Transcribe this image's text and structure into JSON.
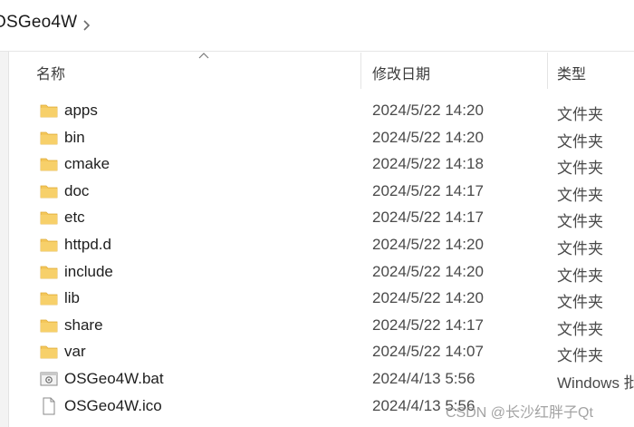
{
  "breadcrumb": {
    "label": "OSGeo4W"
  },
  "columns": {
    "name": "名称",
    "date": "修改日期",
    "type": "类型"
  },
  "files": [
    {
      "name": "apps",
      "date": "2024/5/22 14:20",
      "type": "文件夹",
      "icon": "folder-icon"
    },
    {
      "name": "bin",
      "date": "2024/5/22 14:20",
      "type": "文件夹",
      "icon": "folder-icon"
    },
    {
      "name": "cmake",
      "date": "2024/5/22 14:18",
      "type": "文件夹",
      "icon": "folder-icon"
    },
    {
      "name": "doc",
      "date": "2024/5/22 14:17",
      "type": "文件夹",
      "icon": "folder-icon"
    },
    {
      "name": "etc",
      "date": "2024/5/22 14:17",
      "type": "文件夹",
      "icon": "folder-icon"
    },
    {
      "name": "httpd.d",
      "date": "2024/5/22 14:20",
      "type": "文件夹",
      "icon": "folder-icon"
    },
    {
      "name": "include",
      "date": "2024/5/22 14:20",
      "type": "文件夹",
      "icon": "folder-icon"
    },
    {
      "name": "lib",
      "date": "2024/5/22 14:20",
      "type": "文件夹",
      "icon": "folder-icon"
    },
    {
      "name": "share",
      "date": "2024/5/22 14:17",
      "type": "文件夹",
      "icon": "folder-icon"
    },
    {
      "name": "var",
      "date": "2024/5/22 14:07",
      "type": "文件夹",
      "icon": "folder-icon"
    },
    {
      "name": "OSGeo4W.bat",
      "date": "2024/4/13 5:56",
      "type": "Windows 批",
      "icon": "batch-file-icon"
    },
    {
      "name": "OSGeo4W.ico",
      "date": "2024/4/13 5:56",
      "type": "",
      "icon": "ico-file-icon"
    }
  ],
  "watermark": {
    "text": "CSDN @长沙红胖子Qt"
  },
  "colors": {
    "folder": "#f4c75a",
    "folder_dark": "#e0ad3a",
    "header_text": "#3c3c3c",
    "chevron": "#6a6a6a"
  }
}
